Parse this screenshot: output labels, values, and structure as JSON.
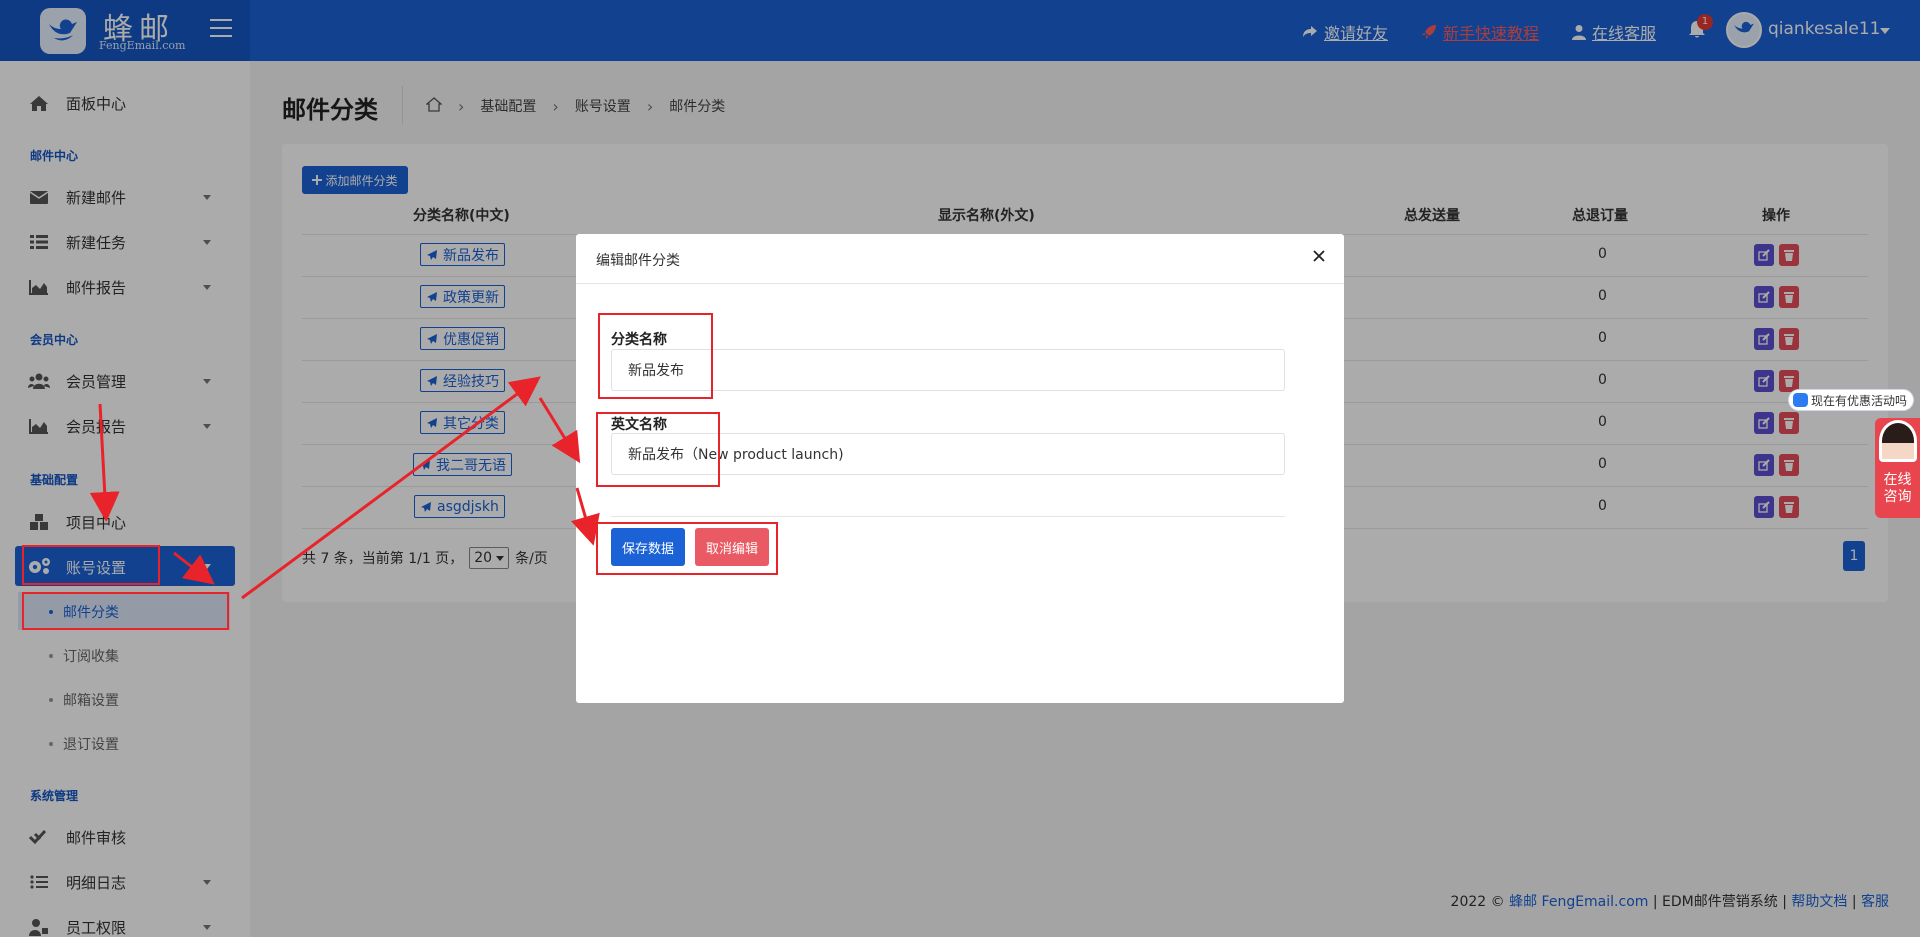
{
  "header": {
    "logo_cn": "蜂邮",
    "logo_en": "FengEmail.com",
    "links": [
      {
        "label": "邀请好友",
        "icon": "share-icon"
      },
      {
        "label": "新手快速教程",
        "icon": "rocket-icon"
      },
      {
        "label": "在线客服",
        "icon": "user-icon"
      }
    ],
    "notification_count": "1",
    "username": "qiankesale11"
  },
  "sidebar": {
    "items": [
      {
        "label": "面板中心",
        "icon": "home-icon"
      },
      {
        "label": "新建邮件",
        "icon": "envelope-icon"
      },
      {
        "label": "新建任务",
        "icon": "list-icon"
      },
      {
        "label": "邮件报告",
        "icon": "area-chart-icon"
      },
      {
        "label": "会员管理",
        "icon": "users-icon"
      },
      {
        "label": "会员报告",
        "icon": "area-chart-icon"
      },
      {
        "label": "项目中心",
        "icon": "cubes-icon"
      },
      {
        "label": "账号设置",
        "icon": "cogs-icon"
      },
      {
        "label": "邮件审核",
        "icon": "double-check-icon"
      },
      {
        "label": "明细日志",
        "icon": "list-ul-icon"
      },
      {
        "label": "员工权限",
        "icon": "user-lock-icon"
      }
    ],
    "sections": [
      "邮件中心",
      "会员中心",
      "基础配置",
      "系统管理"
    ],
    "subitems": [
      "邮件分类",
      "订阅收集",
      "邮箱设置",
      "退订设置"
    ]
  },
  "page": {
    "title": "邮件分类",
    "breadcrumb": [
      "基础配置",
      "账号设置",
      "邮件分类"
    ]
  },
  "table": {
    "add_button": "添加邮件分类",
    "headers": [
      "分类名称(中文)",
      "显示名称(外文)",
      "总发送量",
      "总退订量",
      "操作"
    ],
    "rows": [
      {
        "name": "新品发布",
        "unsub": "0"
      },
      {
        "name": "政策更新",
        "unsub": "0"
      },
      {
        "name": "优惠促销",
        "unsub": "0"
      },
      {
        "name": "经验技巧",
        "unsub": "0"
      },
      {
        "name": "其它分类",
        "unsub": "0"
      },
      {
        "name": "我二哥无语",
        "unsub": "0"
      },
      {
        "name": "asgdjskh",
        "unsub": "0"
      }
    ],
    "pager_text": "共 7 条，当前第 1/1 页，",
    "page_size": "20",
    "page_size_unit": "条/页",
    "current_page": "1"
  },
  "modal": {
    "title": "编辑邮件分类",
    "field1_label": "分类名称",
    "field1_value": "新品发布",
    "field2_label": "英文名称",
    "field2_value": "新品发布（New product launch)",
    "save_label": "保存数据",
    "cancel_label": "取消编辑"
  },
  "footer": {
    "year": "2022 ©",
    "brand": "蜂邮 FengEmail.com",
    "sep1": "|",
    "system": "EDM邮件营销系统",
    "sep2": "|",
    "help": "帮助文档",
    "sep3": "|",
    "service": "客服"
  },
  "chat": {
    "bubble": "现在有优惠活动吗",
    "line1": "在线",
    "line2": "咨询"
  },
  "colors": {
    "primary": "#1a62d6",
    "danger": "#ea5a64",
    "annotation": "#e8232a"
  }
}
